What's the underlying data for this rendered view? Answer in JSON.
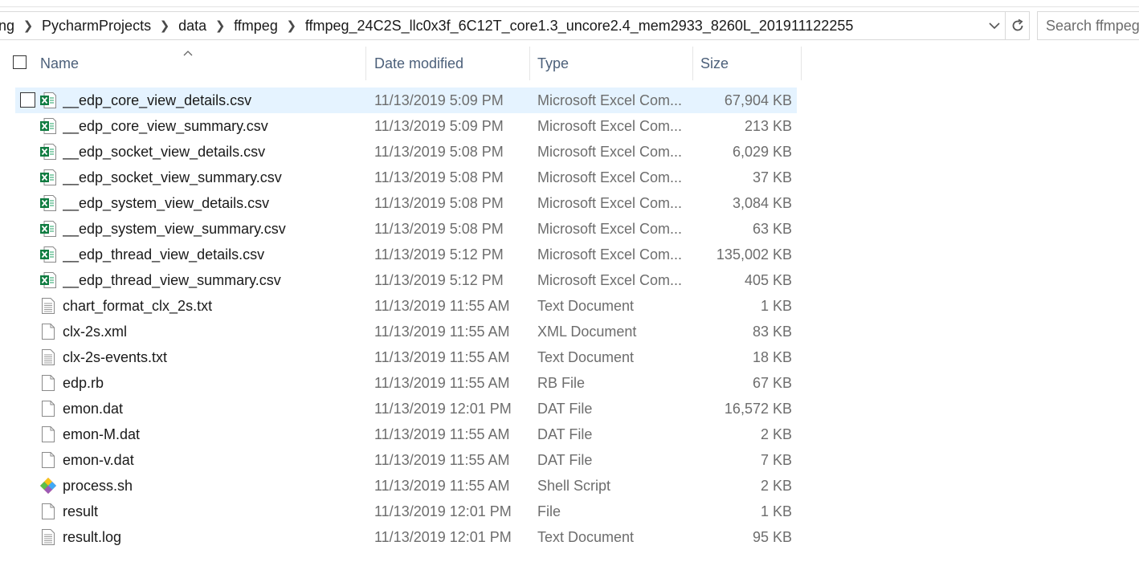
{
  "address_bar": {
    "crumbs": [
      "ng",
      "PycharmProjects",
      "data",
      "ffmpeg",
      "ffmpeg_24C2S_llc0x3f_6C12T_core1.3_uncore2.4_mem2933_8260L_201911122255"
    ],
    "dropdown_icon": "chevron-down-icon",
    "refresh_icon": "refresh-icon"
  },
  "search": {
    "placeholder": "Search ffmpeg"
  },
  "columns": {
    "name": "Name",
    "date": "Date modified",
    "type": "Type",
    "size": "Size"
  },
  "files": [
    {
      "name": "__edp_core_view_details.csv",
      "date": "11/13/2019 5:09 PM",
      "type": "Microsoft Excel Com...",
      "size": "67,904 KB",
      "icon": "excel-file-icon",
      "selected": true
    },
    {
      "name": "__edp_core_view_summary.csv",
      "date": "11/13/2019 5:09 PM",
      "type": "Microsoft Excel Com...",
      "size": "213 KB",
      "icon": "excel-file-icon"
    },
    {
      "name": "__edp_socket_view_details.csv",
      "date": "11/13/2019 5:08 PM",
      "type": "Microsoft Excel Com...",
      "size": "6,029 KB",
      "icon": "excel-file-icon"
    },
    {
      "name": "__edp_socket_view_summary.csv",
      "date": "11/13/2019 5:08 PM",
      "type": "Microsoft Excel Com...",
      "size": "37 KB",
      "icon": "excel-file-icon"
    },
    {
      "name": "__edp_system_view_details.csv",
      "date": "11/13/2019 5:08 PM",
      "type": "Microsoft Excel Com...",
      "size": "3,084 KB",
      "icon": "excel-file-icon"
    },
    {
      "name": "__edp_system_view_summary.csv",
      "date": "11/13/2019 5:08 PM",
      "type": "Microsoft Excel Com...",
      "size": "63 KB",
      "icon": "excel-file-icon"
    },
    {
      "name": "__edp_thread_view_details.csv",
      "date": "11/13/2019 5:12 PM",
      "type": "Microsoft Excel Com...",
      "size": "135,002 KB",
      "icon": "excel-file-icon"
    },
    {
      "name": "__edp_thread_view_summary.csv",
      "date": "11/13/2019 5:12 PM",
      "type": "Microsoft Excel Com...",
      "size": "405 KB",
      "icon": "excel-file-icon"
    },
    {
      "name": "chart_format_clx_2s.txt",
      "date": "11/13/2019 11:55 AM",
      "type": "Text Document",
      "size": "1 KB",
      "icon": "text-file-icon"
    },
    {
      "name": "clx-2s.xml",
      "date": "11/13/2019 11:55 AM",
      "type": "XML Document",
      "size": "83 KB",
      "icon": "blank-file-icon"
    },
    {
      "name": "clx-2s-events.txt",
      "date": "11/13/2019 11:55 AM",
      "type": "Text Document",
      "size": "18 KB",
      "icon": "text-file-icon"
    },
    {
      "name": "edp.rb",
      "date": "11/13/2019 11:55 AM",
      "type": "RB File",
      "size": "67 KB",
      "icon": "blank-file-icon"
    },
    {
      "name": "emon.dat",
      "date": "11/13/2019 12:01 PM",
      "type": "DAT File",
      "size": "16,572 KB",
      "icon": "blank-file-icon"
    },
    {
      "name": "emon-M.dat",
      "date": "11/13/2019 11:55 AM",
      "type": "DAT File",
      "size": "2 KB",
      "icon": "blank-file-icon"
    },
    {
      "name": "emon-v.dat",
      "date": "11/13/2019 11:55 AM",
      "type": "DAT File",
      "size": "7 KB",
      "icon": "blank-file-icon"
    },
    {
      "name": "process.sh",
      "date": "11/13/2019 11:55 AM",
      "type": "Shell Script",
      "size": "2 KB",
      "icon": "git-shell-icon"
    },
    {
      "name": "result",
      "date": "11/13/2019 12:01 PM",
      "type": "File",
      "size": "1 KB",
      "icon": "blank-file-icon"
    },
    {
      "name": "result.log",
      "date": "11/13/2019 12:01 PM",
      "type": "Text Document",
      "size": "95 KB",
      "icon": "text-file-icon"
    }
  ]
}
